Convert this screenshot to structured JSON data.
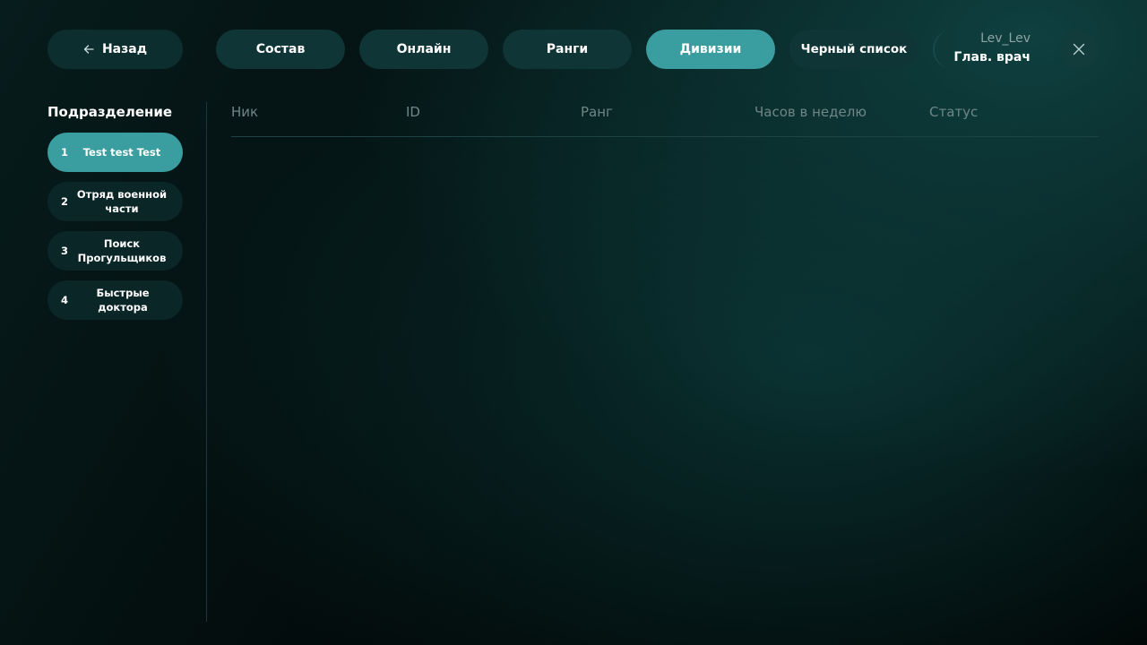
{
  "header": {
    "back_label": "Назад",
    "tabs": [
      {
        "label": "Состав",
        "active": false
      },
      {
        "label": "Онлайн",
        "active": false
      },
      {
        "label": "Ранги",
        "active": false
      },
      {
        "label": "Дивизии",
        "active": true
      },
      {
        "label": "Черный список",
        "active": false
      }
    ],
    "user": {
      "name": "Lev_Lev",
      "rank": "Глав. врач"
    },
    "icons": {
      "back": "arrow-left-icon",
      "close": "close-icon"
    }
  },
  "sidebar": {
    "title": "Подразделение",
    "items": [
      {
        "num": "1",
        "label": "Test test Test",
        "active": true
      },
      {
        "num": "2",
        "label": "Отряд военной части",
        "active": false
      },
      {
        "num": "3",
        "label": "Поиск Прогульщиков",
        "active": false
      },
      {
        "num": "4",
        "label": "Быстрые доктора",
        "active": false
      }
    ]
  },
  "table": {
    "columns": [
      "Ник",
      "ID",
      "Ранг",
      "Часов в неделю",
      "Статус"
    ],
    "rows": []
  },
  "colors": {
    "accent": "#3a9ea0",
    "pill": "#0f3536",
    "muted_text": "#6f8687"
  }
}
